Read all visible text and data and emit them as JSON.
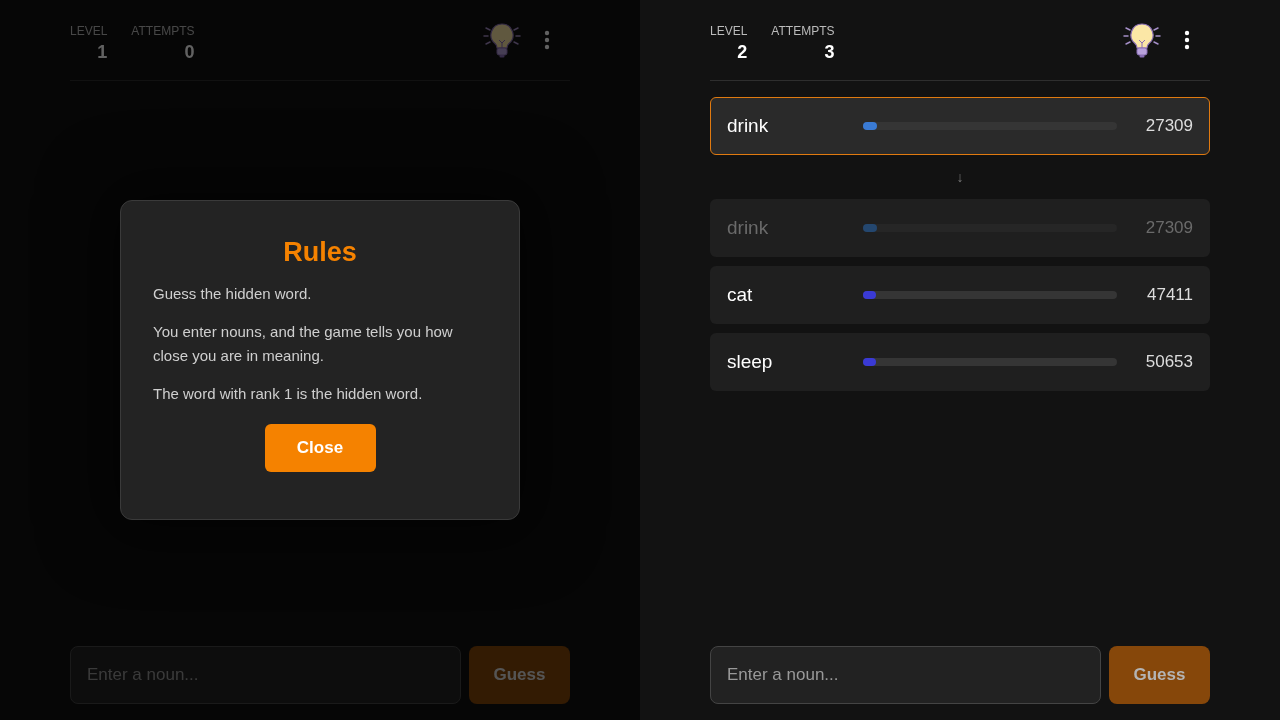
{
  "panels": [
    {
      "stats": [
        {
          "label": "LEVEL",
          "value": "1"
        },
        {
          "label": "ATTEMPTS",
          "value": "0"
        }
      ],
      "input": {
        "placeholder": "Enter a noun..."
      },
      "guess_button": {
        "label": "Guess",
        "disabled": true
      },
      "dialog": {
        "title": "Rules",
        "paragraphs": [
          "Guess the hidden word.",
          "You enter nouns, and the game tells you how close you are in meaning.",
          "The word with rank 1 is the hidden word."
        ],
        "close_button": "Close"
      }
    },
    {
      "stats": [
        {
          "label": "LEVEL",
          "value": "2"
        },
        {
          "label": "ATTEMPTS",
          "value": "3"
        }
      ],
      "latest": {
        "word": "drink",
        "rank": "27309",
        "level": 0.055,
        "color": "#3a7bd5"
      },
      "separator": "↓",
      "guesses": [
        {
          "word": "drink",
          "rank": "27309",
          "level": 0.055,
          "color": "#24476f",
          "faded": true
        },
        {
          "word": "cat",
          "rank": "47411",
          "level": 0.05,
          "color": "#3a3ad5",
          "faded": false
        },
        {
          "word": "sleep",
          "rank": "50653",
          "level": 0.05,
          "color": "#3a3ad5",
          "faded": false
        }
      ],
      "input": {
        "placeholder": "Enter a noun..."
      },
      "guess_button": {
        "label": "Guess",
        "disabled": true
      }
    }
  ]
}
